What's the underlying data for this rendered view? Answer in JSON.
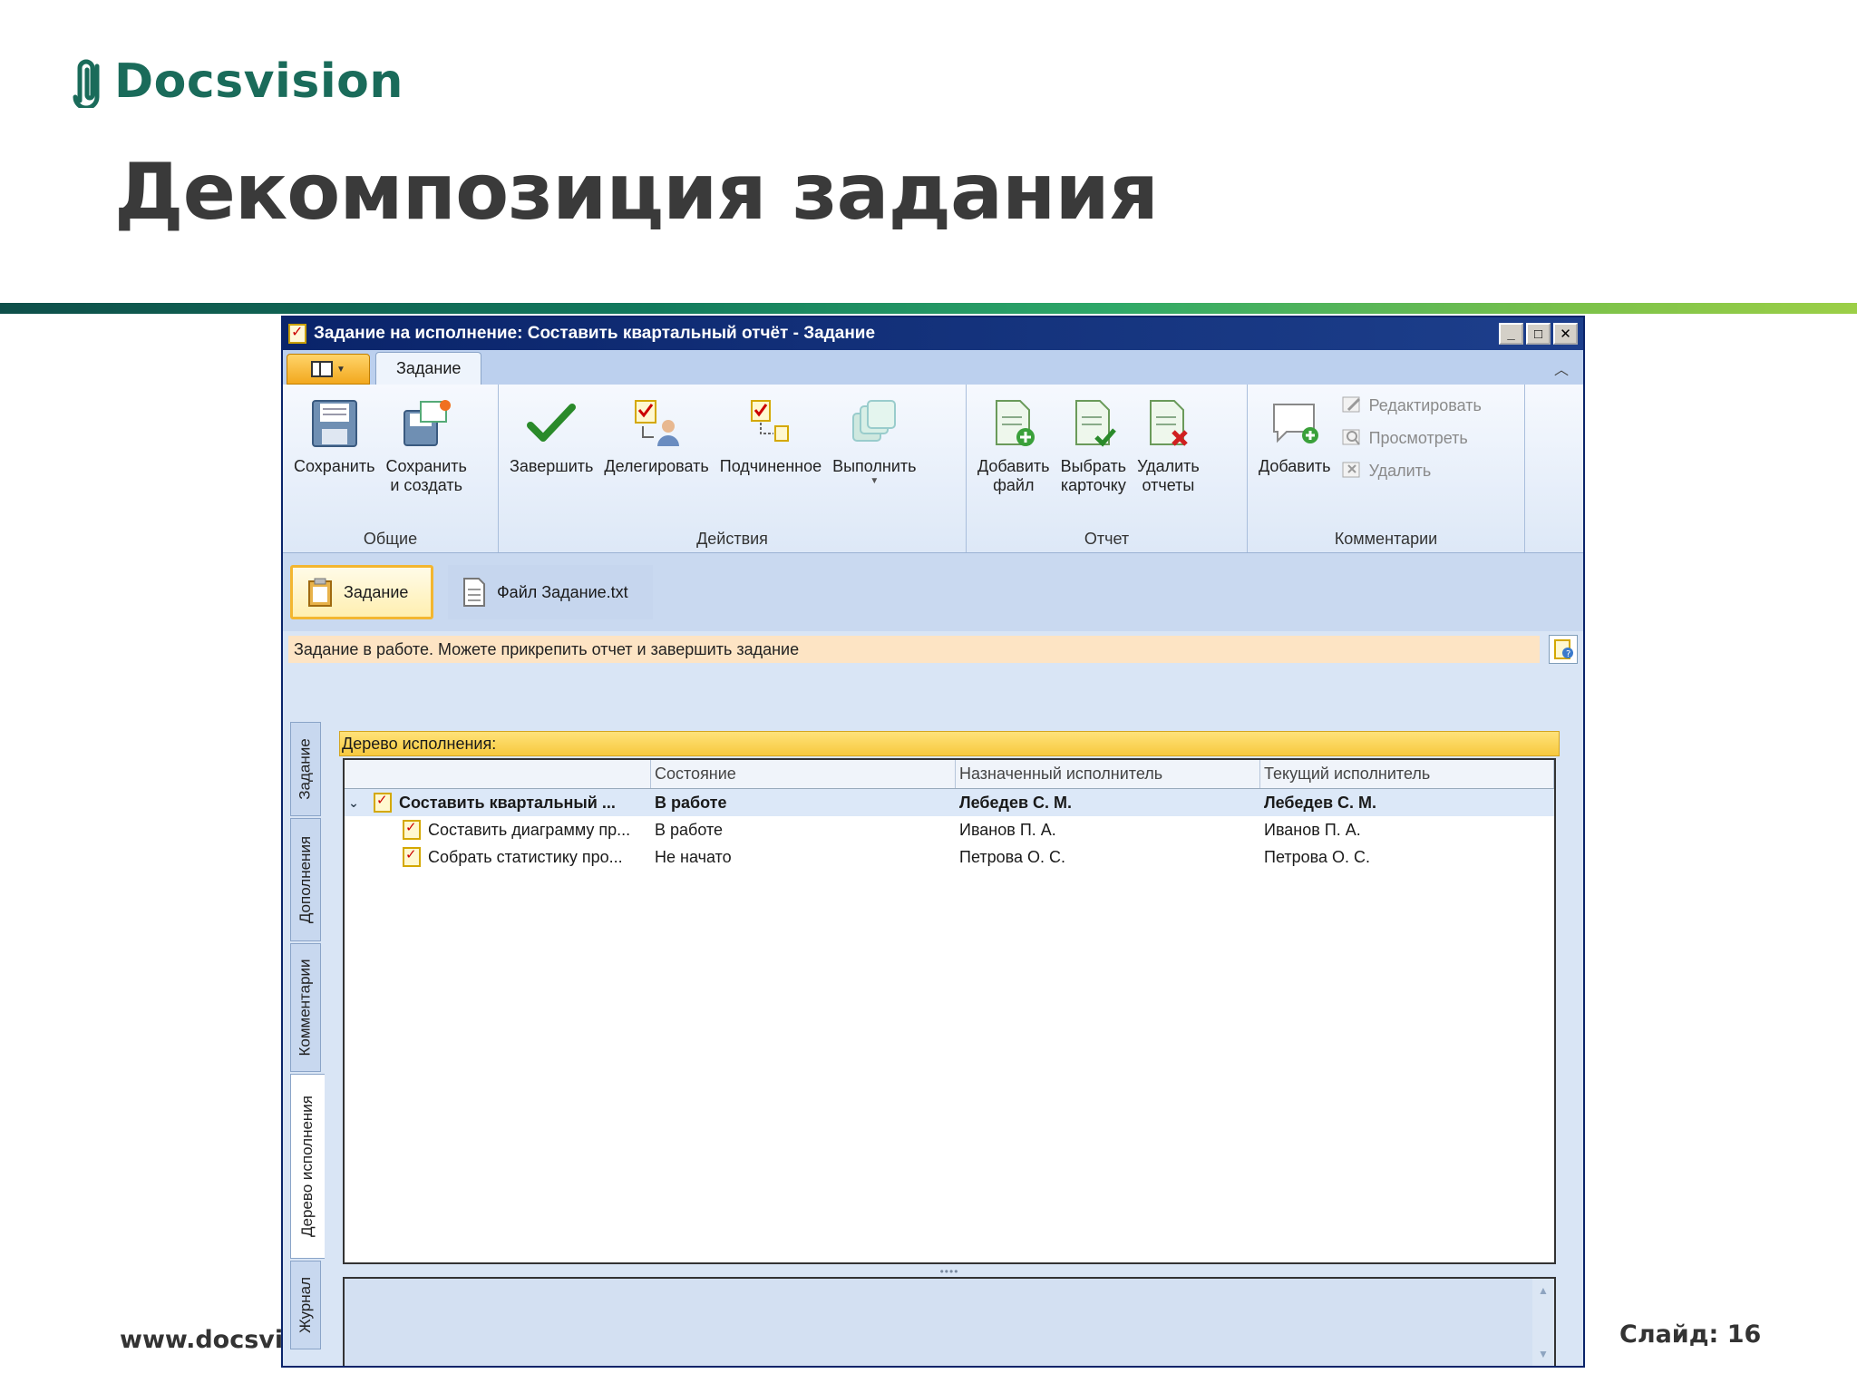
{
  "slide": {
    "logo_text": "Docsvision",
    "title": "Декомпозиция задания",
    "footer_url": "www.docsvisi",
    "slide_number": "Слайд: 16",
    "accent_colors": [
      "#0e4f4a",
      "#2ea868",
      "#9ccf47"
    ]
  },
  "window": {
    "title": "Задание на исполнение: Составить квартальный отчёт - Задание",
    "controls": {
      "minimize": "_",
      "maximize": "□",
      "close": "✕"
    }
  },
  "ribbon": {
    "tab": "Задание",
    "groups": [
      {
        "label": "Общие",
        "buttons": [
          "Сохранить",
          "Сохранить\nи создать"
        ]
      },
      {
        "label": "Действия",
        "buttons": [
          "Завершить",
          "Делегировать",
          "Подчиненное",
          "Выполнить"
        ]
      },
      {
        "label": "Отчет",
        "buttons": [
          "Добавить\nфайл",
          "Выбрать\nкарточку",
          "Удалить\nотчеты"
        ]
      },
      {
        "label": "Комментарии",
        "buttons": [
          "Добавить"
        ],
        "small_buttons": [
          "Редактировать",
          "Просмотреть",
          "Удалить"
        ]
      }
    ]
  },
  "doc_tabs": [
    "Задание",
    "Файл Задание.txt"
  ],
  "status_message": "Задание в работе. Можете прикрепить отчет и завершить задание",
  "side_tabs": [
    "Задание",
    "Дополнения",
    "Комментарии",
    "Дерево исполнения",
    "Журнал"
  ],
  "tree": {
    "header": "Дерево исполнения:",
    "columns": [
      "",
      "Состояние",
      "Назначенный исполнитель",
      "Текущий исполнитель"
    ],
    "rows": [
      {
        "name": "Составить квартальный ...",
        "state": "В работе",
        "assigned": "Лебедев С. М.",
        "current": "Лебедев С. М."
      },
      {
        "name": "Составить диаграмму пр...",
        "state": "В работе",
        "assigned": "Иванов П. А.",
        "current": "Иванов П. А."
      },
      {
        "name": "Собрать статистику про...",
        "state": "Не начато",
        "assigned": "Петрова О. С.",
        "current": "Петрова О. С."
      }
    ]
  }
}
